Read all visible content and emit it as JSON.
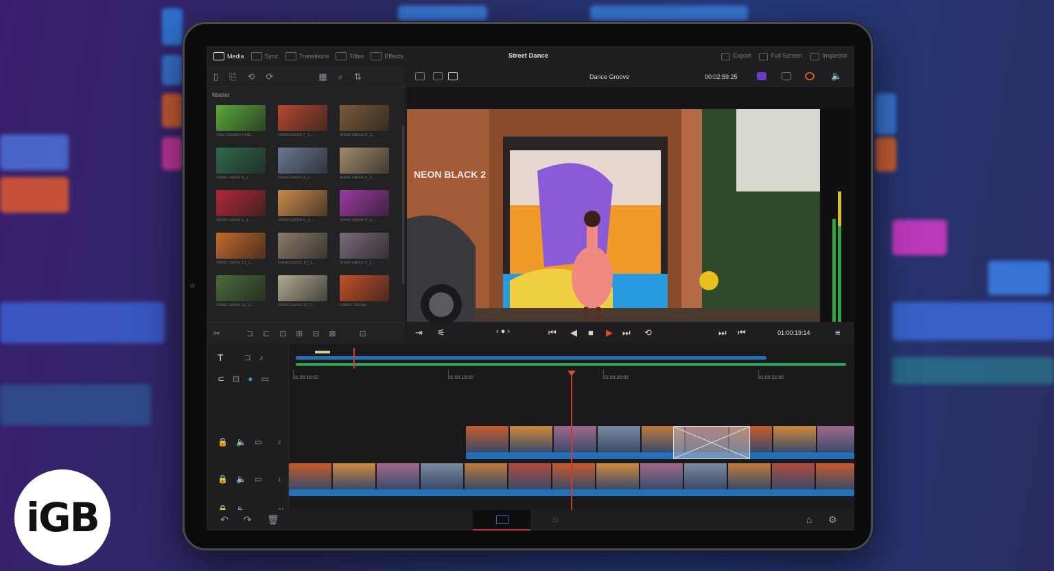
{
  "topbar": {
    "tabs": [
      {
        "label": "Media",
        "icon": "media-icon",
        "active": true
      },
      {
        "label": "Sync",
        "icon": "sync-icon",
        "active": false
      },
      {
        "label": "Transitions",
        "icon": "transitions-icon",
        "active": false
      },
      {
        "label": "Titles",
        "icon": "titles-icon",
        "active": false
      },
      {
        "label": "Effects",
        "icon": "effects-icon",
        "active": false
      }
    ],
    "project_title": "Street Dance",
    "right": [
      {
        "label": "Export",
        "icon": "export-icon"
      },
      {
        "label": "Full Screen",
        "icon": "fullscreen-icon"
      },
      {
        "label": "Inspector",
        "icon": "inspector-icon"
      }
    ]
  },
  "mediapool": {
    "folder": "Master",
    "clips": [
      {
        "name": "Soul Dancers Feat...",
        "color": "#5aa83c"
      },
      {
        "name": "Street Dance 7_1...",
        "color": "#b5492e"
      },
      {
        "name": "Street Dance 9_1...",
        "color": "#7a5a3a"
      },
      {
        "name": "Street Dance 4_1...",
        "color": "#2f6a4a"
      },
      {
        "name": "Street Dance 3_1...",
        "color": "#6a7890"
      },
      {
        "name": "Street Dance 2_1...",
        "color": "#a08a6a"
      },
      {
        "name": "Street Dance 1_1...",
        "color": "#b02a36"
      },
      {
        "name": "Street Dance 6_1...",
        "color": "#c88a4a"
      },
      {
        "name": "Street Dance 8_1...",
        "color": "#9a3aa0"
      },
      {
        "name": "Street Dance 13_1...",
        "color": "#c46a2a"
      },
      {
        "name": "Street Dance 10_1...",
        "color": "#8a7a6a"
      },
      {
        "name": "Street Dance 5_1...",
        "color": "#7a6a7a"
      },
      {
        "name": "Street Dance 12_1...",
        "color": "#4a6a3a"
      },
      {
        "name": "Street Dance 11_1...",
        "color": "#b0a890"
      },
      {
        "name": "Dance Groove",
        "color": "#c2502a"
      }
    ]
  },
  "viewer": {
    "clip_name": "Dance Groove",
    "timecode_top": "00:02:59:25",
    "timecode_bottom": "01:00:19:14"
  },
  "timeline": {
    "ruler": [
      "01:00:16:00",
      "01:00:18:00",
      "01:00:20:00",
      "01:00:22:00"
    ],
    "tracks": [
      {
        "label": "2"
      },
      {
        "label": "1"
      },
      {
        "label": "A1"
      }
    ]
  },
  "colors": {
    "accent_red": "#e04a2f",
    "clip_blue": "#2370b8",
    "audio_green": "#27a153"
  },
  "logo": {
    "text": "iGB"
  }
}
